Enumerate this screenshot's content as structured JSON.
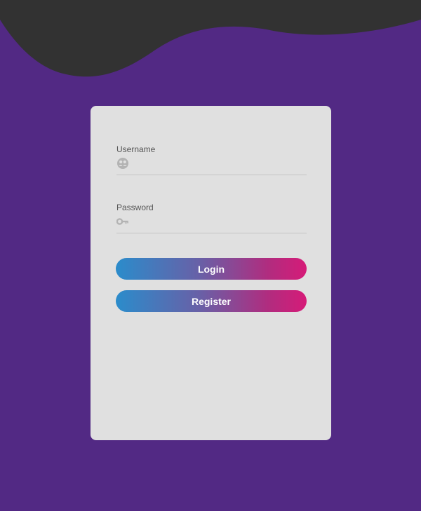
{
  "background": {
    "top_color": "#323232",
    "main_color": "#522984"
  },
  "form": {
    "username": {
      "label": "Username",
      "value": "",
      "icon": "user-circle-icon"
    },
    "password": {
      "label": "Password",
      "value": "",
      "icon": "key-icon"
    },
    "login_label": "Login",
    "register_label": "Register"
  },
  "colors": {
    "card": "#e0e0e0",
    "button_gradient_start": "#2b8ccb",
    "button_gradient_end": "#d61b78"
  }
}
